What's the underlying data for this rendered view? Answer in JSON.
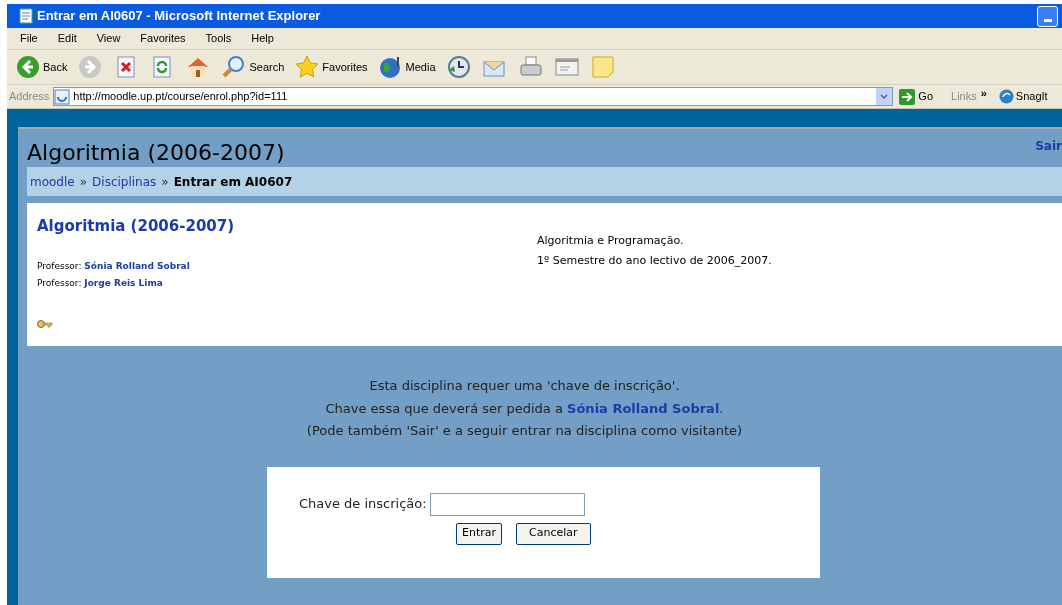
{
  "window": {
    "title": "Entrar em AI0607 - Microsoft Internet Explorer"
  },
  "menu": [
    "File",
    "Edit",
    "View",
    "Favorites",
    "Tools",
    "Help"
  ],
  "toolbar": [
    {
      "kind": "back",
      "label": "Back"
    },
    {
      "kind": "forward"
    },
    {
      "kind": "stop"
    },
    {
      "kind": "refresh"
    },
    {
      "kind": "home"
    },
    {
      "kind": "search",
      "label": "Search"
    },
    {
      "kind": "favorites",
      "label": "Favorites"
    },
    {
      "kind": "media",
      "label": "Media"
    },
    {
      "kind": "history"
    },
    {
      "kind": "mail"
    },
    {
      "kind": "print"
    },
    {
      "kind": "edit"
    },
    {
      "kind": "note"
    }
  ],
  "address": {
    "label": "Address",
    "url": "http://moodle.up.pt/course/enrol.php?id=111",
    "go": "Go",
    "links": "Links",
    "links_more": "»",
    "snagit": "SnagIt"
  },
  "page": {
    "header_title": "Algoritmia (2006-2007)",
    "logout": "Sair",
    "breadcrumb": [
      {
        "text": "moodle",
        "link": true
      },
      {
        "text": "Disciplinas",
        "link": true
      },
      {
        "text": "Entrar em AI0607",
        "link": false
      }
    ],
    "breadcrumb_separator": "»",
    "course": {
      "title": "Algoritmia (2006-2007)",
      "teachers": [
        {
          "role": "Professor:",
          "name": "Sónia Rolland Sobral"
        },
        {
          "role": "Professor:",
          "name": "Jorge Reis Lima"
        }
      ],
      "summary": [
        "Algoritmia e Programação.",
        "1º Semestre do ano lectivo de 2006_2007."
      ]
    },
    "message": {
      "line1": "Esta disciplina requer uma 'chave de inscrição'.",
      "line2_before": "Chave essa que deverá ser pedida a ",
      "line2_link": "Sónia Rolland Sobral",
      "line2_after": ".",
      "line3": "(Pode também 'Sair' e a seguir entrar na disciplina como visitante)"
    },
    "form": {
      "label": "Chave de inscrição:",
      "submit": "Entrar",
      "cancel": "Cancelar"
    }
  }
}
